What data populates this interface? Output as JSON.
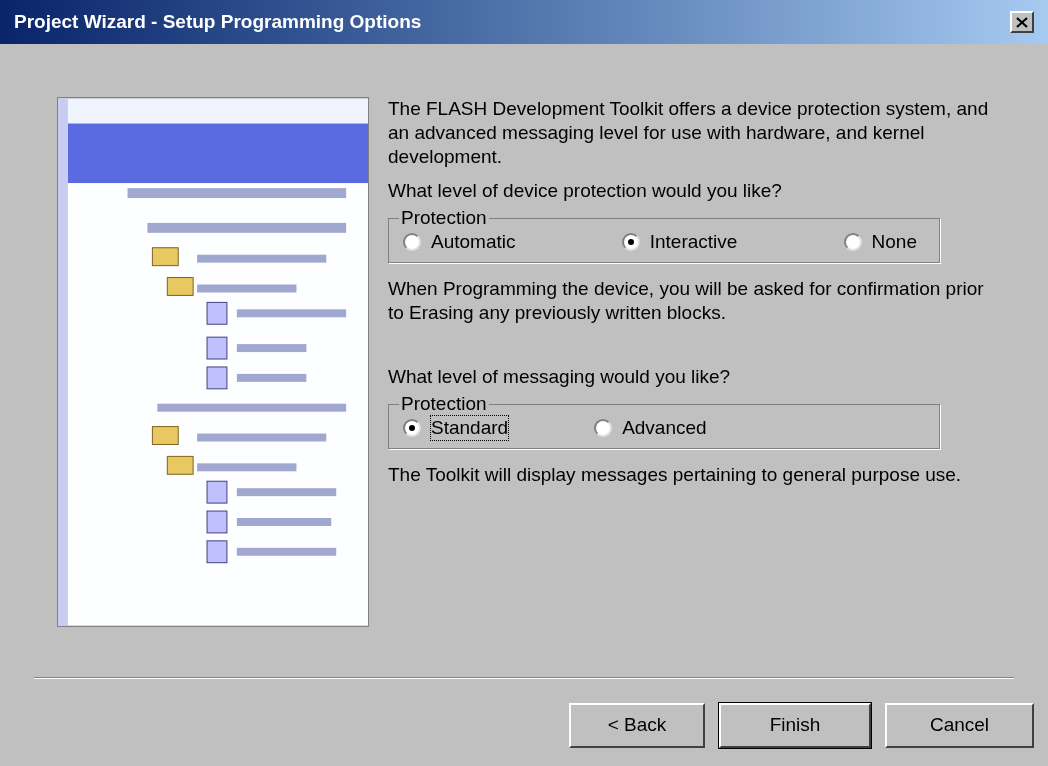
{
  "window": {
    "title": "Project Wizard - Setup Programming Options"
  },
  "intro": "The FLASH Development Toolkit offers a device protection system, and an advanced messaging level for use with hardware, and kernel development.",
  "protection_question": "What level of device protection would you like?",
  "protection_group": {
    "label": "Protection",
    "options": [
      {
        "label": "Automatic",
        "selected": false
      },
      {
        "label": "Interactive",
        "selected": true
      },
      {
        "label": "None",
        "selected": false
      }
    ]
  },
  "protection_note": "When Programming the device, you will be asked for confirmation prior to Erasing any previously written blocks.",
  "messaging_question": "What level of messaging would you like?",
  "messaging_group": {
    "label": "Protection",
    "options": [
      {
        "label": "Standard",
        "selected": true,
        "focused": true
      },
      {
        "label": "Advanced",
        "selected": false,
        "focused": false
      }
    ]
  },
  "messaging_note": "The Toolkit will display messages pertaining to general purpose use.",
  "buttons": [
    {
      "label": "< Back",
      "default": false
    },
    {
      "label": "Finish",
      "default": true
    },
    {
      "label": "Cancel",
      "default": false
    }
  ]
}
